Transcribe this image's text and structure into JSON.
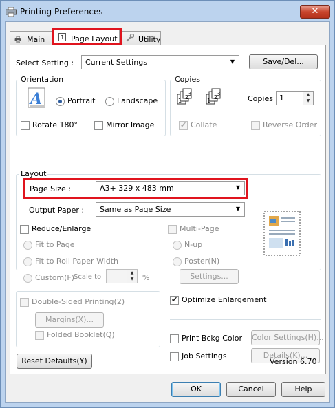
{
  "window": {
    "title": "Printing Preferences",
    "close_glyph": "✕"
  },
  "tabs": [
    {
      "label": "Main",
      "icon": "printer-icon"
    },
    {
      "label": "Page Layout",
      "icon": "page-icon"
    },
    {
      "label": "Utility",
      "icon": "wrench-icon"
    }
  ],
  "select_setting": {
    "label": "Select Setting :",
    "value": "Current Settings",
    "save_label": "Save/Del..."
  },
  "orientation": {
    "title": "Orientation",
    "portrait": "Portrait",
    "landscape": "Landscape",
    "selected": "portrait",
    "rotate_label": "Rotate 180°",
    "mirror_label": "Mirror Image"
  },
  "copies": {
    "title": "Copies",
    "copies_label": "Copies :",
    "copies_value": "1",
    "collate_label": "Collate",
    "reverse_label": "Reverse Order"
  },
  "layout": {
    "title": "Layout",
    "page_size_label": "Page Size :",
    "page_size_value": "A3+ 329 x 483 mm",
    "output_paper_label": "Output Paper :",
    "output_paper_value": "Same as Page Size",
    "reduce_label": "Reduce/Enlarge",
    "fit_page": "Fit to Page",
    "fit_roll": "Fit to Roll Paper Width",
    "custom": "Custom(F)",
    "scale_to": "Scale to",
    "percent": "%",
    "multi_page": "Multi-Page",
    "n_up": "N-up",
    "poster": "Poster(N)",
    "settings_btn": "Settings..."
  },
  "duplex": {
    "double_sided": "Double-Sided Printing(2)",
    "margins_btn": "Margins(X)...",
    "folded": "Folded Booklet(Q)",
    "optimize": "Optimize Enlargement",
    "print_bckg": "Print Bckg Color",
    "color_settings_btn": "Color Settings(H)...",
    "job_settings": "Job Settings",
    "details_btn": "Details(K)..."
  },
  "footer": {
    "reset_btn": "Reset Defaults(Y)",
    "version": "Version 6.70",
    "ok": "OK",
    "cancel": "Cancel",
    "help": "Help"
  },
  "colors": {
    "highlight": "#e0141e",
    "title_bar": "#bcd3ee",
    "close": "#c9462e"
  }
}
